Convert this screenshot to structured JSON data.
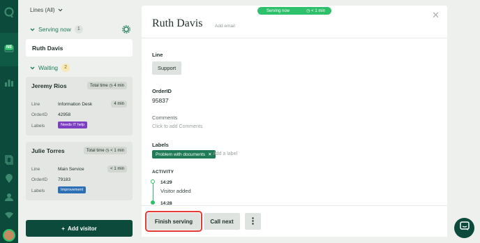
{
  "filter": {
    "label": "Lines (All)"
  },
  "serving_section": {
    "title": "Serving now",
    "count": "1",
    "items": [
      {
        "name": "Ruth Davis"
      }
    ]
  },
  "waiting_section": {
    "title": "Waiting",
    "count": "2",
    "cards": [
      {
        "name": "Jeremy Rios",
        "total_label": "Total time",
        "total_time": "4 min",
        "line_label": "Line",
        "line": "Information Desk",
        "line_time": "4 min",
        "order_label": "OrderID",
        "order_id": "42958",
        "labels_label": "Labels",
        "tag": "Needs IT help",
        "tag_color": "#7c3fc2"
      },
      {
        "name": "Julie Torres",
        "total_label": "Total time",
        "total_time": "< 1 min",
        "line_label": "Line",
        "line": "Main Service",
        "line_time": "< 1 min",
        "order_label": "OrderID",
        "order_id": "79183",
        "labels_label": "Labels",
        "tag": "Improvement",
        "tag_color": "#2d6fb5"
      }
    ]
  },
  "add_visitor": "Add visitor",
  "rail": {
    "badge": "NE"
  },
  "detail": {
    "status_pill": {
      "label": "Serving now",
      "time": "< 1 min"
    },
    "name": "Ruth Davis",
    "add_email": "Add email",
    "line_label": "Line",
    "line_value": "Support",
    "order_label": "OrderID",
    "order_value": "95837",
    "comments_label": "Comments",
    "comments_placeholder": "Click to add Comments",
    "labels_label": "Labels",
    "label_chip": "Problem with documents",
    "add_label": "Add a label",
    "activity_label": "ACTIVITY",
    "activity": [
      {
        "time": "14:29",
        "text": "Visitor added"
      },
      {
        "time": "14:28",
        "text": ""
      }
    ]
  },
  "footer": {
    "finish": "Finish serving",
    "call_next": "Call next"
  },
  "colors": {
    "brand_dark": "#0c4a3b",
    "accent_green": "#2ec06b",
    "highlight": "#e53935"
  }
}
